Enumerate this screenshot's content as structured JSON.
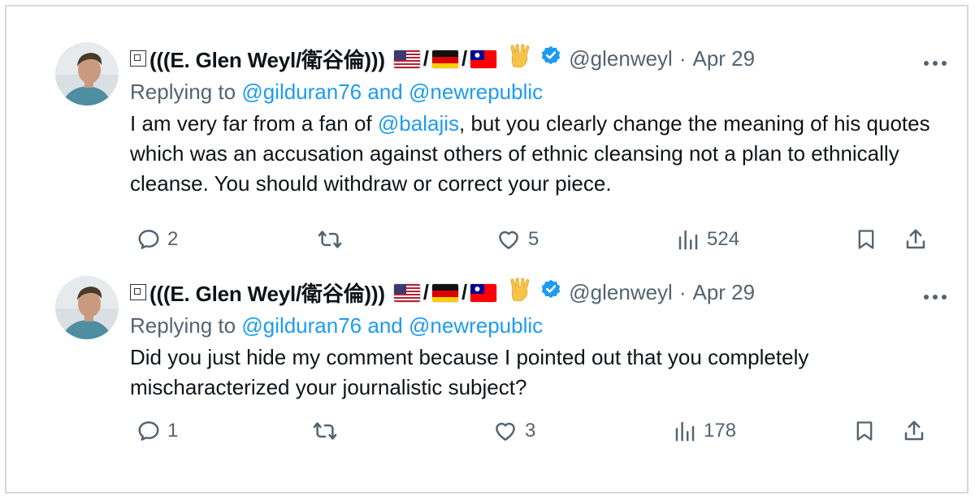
{
  "tweets": [
    {
      "name_prefix": "(((E. Glen Weyl/衛谷倫)))",
      "handle": "@glenweyl",
      "separator": "·",
      "date": "Apr 29",
      "replying_prefix": "Replying to",
      "reply_to_1": "@gilduran76",
      "reply_and": "and",
      "reply_to_2": "@newrepublic",
      "body_part1": "I am very far from a fan of ",
      "body_mention": "@balajis",
      "body_part2": ", but you clearly change the meaning of his quotes which was an accusation against others of ethnic cleansing not a plan to ethnically cleanse.  You should withdraw or correct your piece.",
      "replies": "2",
      "retweets": "",
      "likes": "5",
      "views": "524"
    },
    {
      "name_prefix": "(((E. Glen Weyl/衛谷倫)))",
      "handle": "@glenweyl",
      "separator": "·",
      "date": "Apr 29",
      "replying_prefix": "Replying to",
      "reply_to_1": "@gilduran76",
      "reply_and": "and",
      "reply_to_2": "@newrepublic",
      "body_part1": "Did you just hide my comment because I pointed out that you completely mischaracterized your journalistic subject?",
      "body_mention": "",
      "body_part2": "",
      "replies": "1",
      "retweets": "",
      "likes": "3",
      "views": "178"
    }
  ],
  "icons": {
    "verified": "verified-badge-icon",
    "more": "more-options-icon",
    "reply": "reply-bubble-icon",
    "retweet": "retweet-icon",
    "like": "heart-icon",
    "views": "views-bar-chart-icon",
    "bookmark": "bookmark-icon",
    "share": "share-upload-icon",
    "hand": "vulcan-salute-icon",
    "flags": [
      "us-flag-icon",
      "germany-flag-icon",
      "taiwan-flag-icon"
    ]
  },
  "colors": {
    "link": "#1d9bf0",
    "muted": "#536471",
    "text": "#0f1419",
    "verified": "#1d9bf0"
  }
}
